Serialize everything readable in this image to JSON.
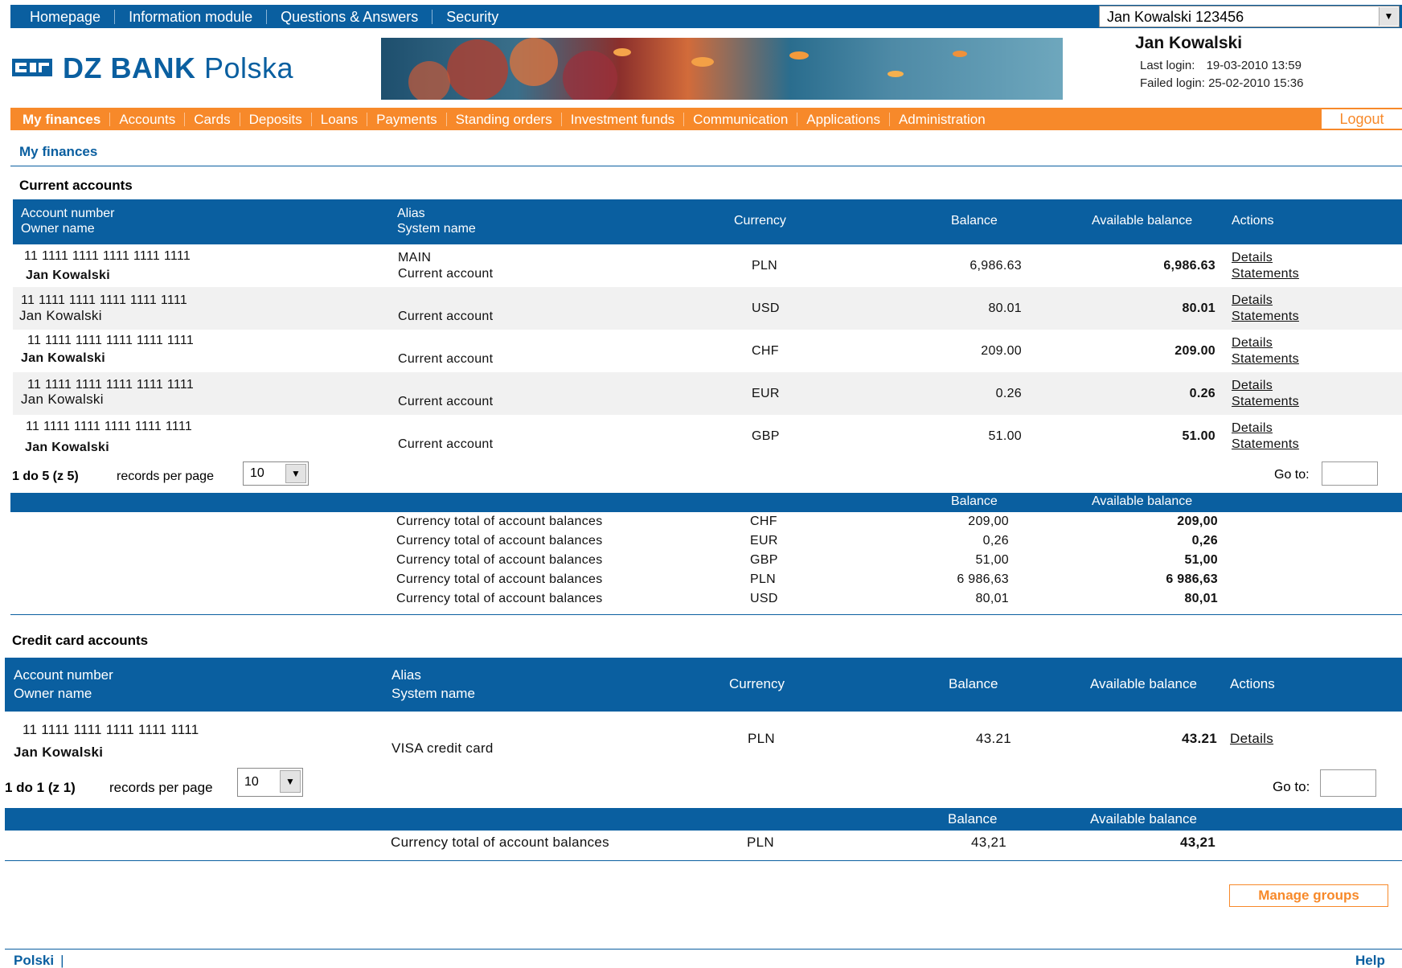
{
  "top_nav": {
    "items": [
      "Homepage",
      "Information module",
      "Questions & Answers",
      "Security"
    ],
    "user_selector": "Jan Kowalski 123456"
  },
  "brand": {
    "bold": "DZ BANK",
    "light": "Polska"
  },
  "user_info": {
    "name": "Jan Kowalski",
    "last_login_label": "Last login:",
    "last_login_value": "19-03-2010 13:59",
    "failed_login_label": "Failed login:",
    "failed_login_value": "25-02-2010 15:36"
  },
  "main_nav": {
    "items": [
      "My finances",
      "Accounts",
      "Cards",
      "Deposits",
      "Loans",
      "Payments",
      "Standing orders",
      "Investment funds",
      "Communication",
      "Applications",
      "Administration"
    ],
    "logout": "Logout"
  },
  "breadcrumb": "My finances",
  "current_accounts": {
    "title": "Current accounts",
    "headers": {
      "account_number": "Account number",
      "owner_name": "Owner name",
      "alias": "Alias",
      "system_name": "System name",
      "currency": "Currency",
      "balance": "Balance",
      "available_balance": "Available balance",
      "actions": "Actions"
    },
    "rows": [
      {
        "number": "11 1111 1111 1111 1111 1111",
        "owner": "Jan Kowalski",
        "alias": "MAIN",
        "system": "Current account",
        "currency": "PLN",
        "balance": "6,986.63",
        "available": "6,986.63",
        "details": "Details",
        "statements": "Statements"
      },
      {
        "number": "11 1111 1111 1111 1111 1111",
        "owner": "Jan Kowalski",
        "alias": "",
        "system": "Current account",
        "currency": "USD",
        "balance": "80.01",
        "available": "80.01",
        "details": "Details",
        "statements": "Statements"
      },
      {
        "number": "11 1111 1111 1111 1111 1111",
        "owner": "Jan Kowalski",
        "alias": "",
        "system": "Current account",
        "currency": "CHF",
        "balance": "209.00",
        "available": "209.00",
        "details": "Details",
        "statements": "Statements"
      },
      {
        "number": "11 1111 1111 1111 1111 1111",
        "owner": "Jan Kowalski",
        "alias": "",
        "system": "Current account",
        "currency": "EUR",
        "balance": "0.26",
        "available": "0.26",
        "details": "Details",
        "statements": "Statements"
      },
      {
        "number": "11 1111 1111 1111 1111 1111",
        "owner": "Jan Kowalski",
        "alias": "",
        "system": "Current account",
        "currency": "GBP",
        "balance": "51.00",
        "available": "51.00",
        "details": "Details",
        "statements": "Statements"
      }
    ],
    "pager": {
      "range": "1 do 5 (z 5)",
      "rpp_label": "records per page",
      "rpp_value": "10",
      "goto_label": "Go to:"
    },
    "totals_header": {
      "balance": "Balance",
      "available": "Available balance"
    },
    "totals": [
      {
        "label": "Currency total of account balances",
        "currency": "CHF",
        "balance": "209,00",
        "available": "209,00"
      },
      {
        "label": "Currency total of account balances",
        "currency": "EUR",
        "balance": "0,26",
        "available": "0,26"
      },
      {
        "label": "Currency total of account balances",
        "currency": "GBP",
        "balance": "51,00",
        "available": "51,00"
      },
      {
        "label": "Currency total of account balances",
        "currency": "PLN",
        "balance": "6 986,63",
        "available": "6 986,63"
      },
      {
        "label": "Currency total of account balances",
        "currency": "USD",
        "balance": "80,01",
        "available": "80,01"
      }
    ]
  },
  "credit_accounts": {
    "title": "Credit card accounts",
    "headers": {
      "account_number": "Account number",
      "owner_name": "Owner name",
      "alias": "Alias",
      "system_name": "System name",
      "currency": "Currency",
      "balance": "Balance",
      "available_balance": "Available balance",
      "actions": "Actions"
    },
    "rows": [
      {
        "number": "11 1111 1111 1111 1111 1111",
        "owner": "Jan Kowalski",
        "system": "VISA credit card",
        "currency": "PLN",
        "balance": "43.21",
        "available": "43.21",
        "details": "Details"
      }
    ],
    "pager": {
      "range": "1 do 1 (z 1)",
      "rpp_label": "records per page",
      "rpp_value": "10",
      "goto_label": "Go to:"
    },
    "totals_header": {
      "balance": "Balance",
      "available": "Available balance"
    },
    "totals": [
      {
        "label": "Currency total of account balances",
        "currency": "PLN",
        "balance": "43,21",
        "available": "43,21"
      }
    ]
  },
  "manage_groups": "Manage groups",
  "footer": {
    "language": "Polski",
    "help": "Help"
  },
  "colors": {
    "brand_blue": "#0a5fa0",
    "brand_orange": "#f7892a"
  }
}
